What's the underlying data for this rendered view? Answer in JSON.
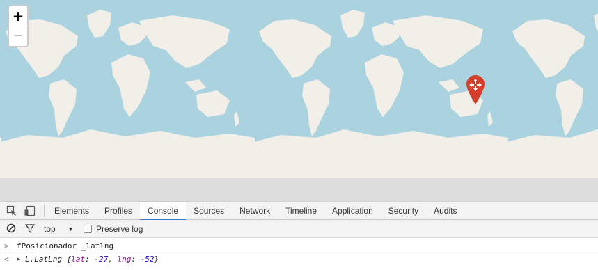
{
  "map": {
    "zoom_in_label": "+",
    "zoom_out_label": "−",
    "colors": {
      "water": "#aad3df",
      "land": "#f2efe9",
      "marker": "#d63e2a"
    }
  },
  "devtools": {
    "tabs": [
      {
        "label": "Elements",
        "active": false
      },
      {
        "label": "Profiles",
        "active": false
      },
      {
        "label": "Console",
        "active": true
      },
      {
        "label": "Sources",
        "active": false
      },
      {
        "label": "Network",
        "active": false
      },
      {
        "label": "Timeline",
        "active": false
      },
      {
        "label": "Application",
        "active": false
      },
      {
        "label": "Security",
        "active": false
      },
      {
        "label": "Audits",
        "active": false
      }
    ],
    "console_toolbar": {
      "context": "top",
      "preserve_log_label": "Preserve log",
      "preserve_log_checked": false
    },
    "console": {
      "input_prompt": ">",
      "output_prompt": "<",
      "command": "fPosicionador._latlng",
      "result_class": "L.LatLng",
      "result_open": "{",
      "lat_key": "lat",
      "lat_value": "-27",
      "sep": ", ",
      "lng_key": "lng",
      "lng_value": "-52",
      "result_close": "}"
    }
  }
}
